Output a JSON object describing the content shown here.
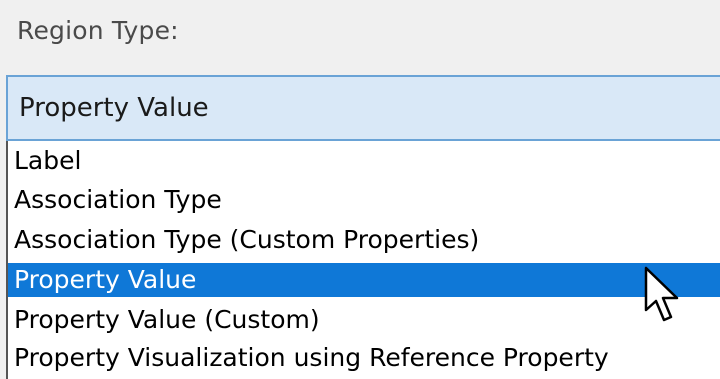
{
  "region_type": {
    "label": "Region Type:",
    "selected_value": "Property Value",
    "options": [
      {
        "label": "Label"
      },
      {
        "label": "Association Type"
      },
      {
        "label": "Association Type (Custom Properties)"
      },
      {
        "label": "Property Value",
        "highlighted": true
      },
      {
        "label": "Property Value (Custom)"
      },
      {
        "label": "Property Visualization using Reference Property"
      }
    ]
  },
  "colors": {
    "highlight": "#0f78d7",
    "combo_background": "#d9e8f7",
    "combo_border": "#6aa3d6"
  },
  "cursor": {
    "icon": "mouse-pointer-icon"
  }
}
